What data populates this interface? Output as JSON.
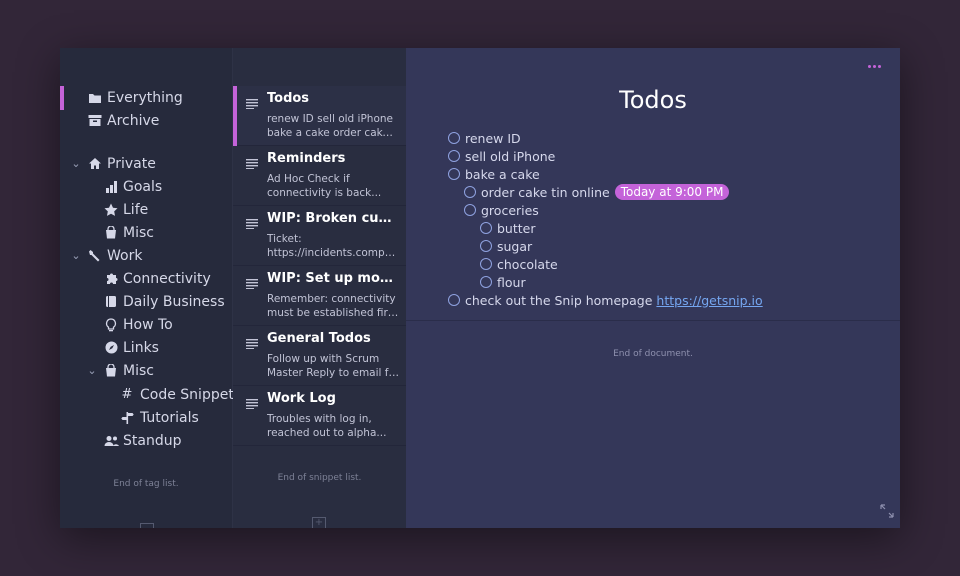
{
  "sidebar": {
    "items": [
      {
        "label": "Everything",
        "icon": "folder-icon"
      },
      {
        "label": "Archive",
        "icon": "archive-icon"
      },
      {
        "label": "Private",
        "icon": "home-icon"
      },
      {
        "label": "Goals",
        "icon": "bar-chart-icon"
      },
      {
        "label": "Life",
        "icon": "star-icon"
      },
      {
        "label": "Misc",
        "icon": "basket-icon"
      },
      {
        "label": "Work",
        "icon": "wrench-icon"
      },
      {
        "label": "Connectivity",
        "icon": "puzzle-icon"
      },
      {
        "label": "Daily Business",
        "icon": "book-icon"
      },
      {
        "label": "How To",
        "icon": "lightbulb-icon"
      },
      {
        "label": "Links",
        "icon": "compass-icon"
      },
      {
        "label": "Misc",
        "icon": "basket-icon"
      },
      {
        "label": "Code Snippets",
        "icon": "hash-icon"
      },
      {
        "label": "Tutorials",
        "icon": "signpost-icon"
      },
      {
        "label": "Standup",
        "icon": "users-icon"
      }
    ],
    "hash_glyph": "#",
    "end_note": "End of tag list."
  },
  "snippets": {
    "items": [
      {
        "title": "Todos",
        "preview1": "renew ID sell old iPhone",
        "preview2": "bake a cake order cake ti..."
      },
      {
        "title": "Reminders",
        "preview1": "Ad Hoc Check if",
        "preview2": "connectivity is back..."
      },
      {
        "title": "WIP: Broken custom...",
        "preview1": "Ticket:",
        "preview2": "https://incidents.compan..."
      },
      {
        "title": "WIP: Set up monitori...",
        "preview1": "Remember: connectivity",
        "preview2": "must be established first ..."
      },
      {
        "title": "General Todos",
        "preview1": "Follow up with Scrum",
        "preview2": "Master Reply to email fro..."
      },
      {
        "title": "Work Log",
        "preview1": "Troubles with log in,",
        "preview2": "reached out to alpha..."
      }
    ],
    "end_note": "End of snippet list.",
    "add_label": "+"
  },
  "editor": {
    "title": "Todos",
    "todos": [
      {
        "text": "renew ID"
      },
      {
        "text": "sell old iPhone"
      },
      {
        "text": "bake a cake"
      },
      {
        "text": "order cake tin online",
        "date": "Today at 9:00 PM"
      },
      {
        "text": "groceries"
      },
      {
        "text": "butter"
      },
      {
        "text": "sugar"
      },
      {
        "text": "chocolate"
      },
      {
        "text": "flour"
      },
      {
        "text": "check out the Snip homepage",
        "link": "https://getsnip.io"
      }
    ],
    "end_note": "End of document."
  },
  "colors": {
    "accent": "#c463d9",
    "sidebar_bg": "#262a3c",
    "list_bg": "#292d40",
    "editor_bg": "#343759",
    "link": "#75a6f0"
  }
}
